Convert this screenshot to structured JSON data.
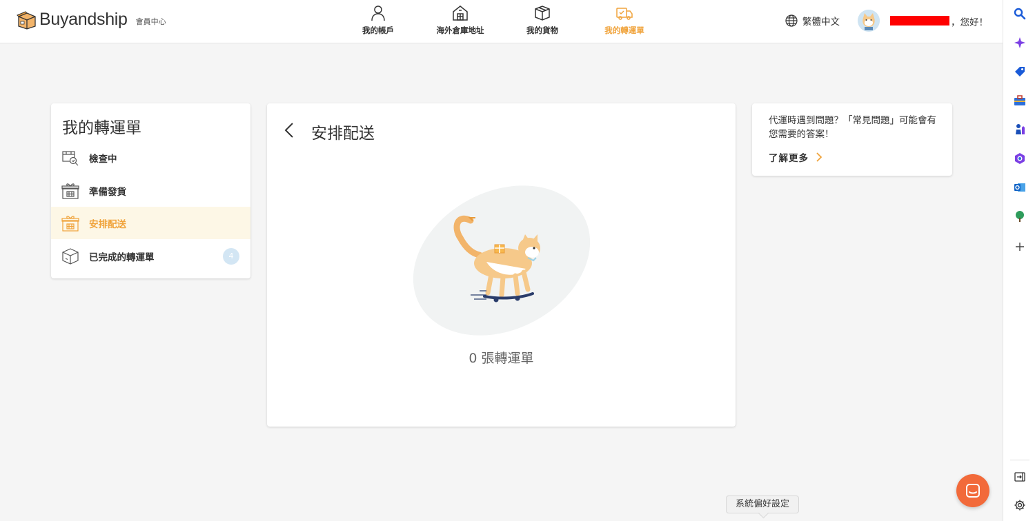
{
  "brand": {
    "name": "Buyandship",
    "subtitle": "會員中心"
  },
  "nav": {
    "items": [
      {
        "label": "我的帳戶",
        "icon": "user-icon"
      },
      {
        "label": "海外倉庫地址",
        "icon": "warehouse-icon"
      },
      {
        "label": "我的貨物",
        "icon": "box-icon"
      },
      {
        "label": "我的轉運單",
        "icon": "truck-icon",
        "active": true
      }
    ]
  },
  "header": {
    "language": "繁體中文",
    "greeting": "，您好！"
  },
  "sidebar": {
    "title": "我的轉運單",
    "items": [
      {
        "label": "檢查中",
        "icon": "inspect-icon"
      },
      {
        "label": "準備發貨",
        "icon": "gift-box-icon"
      },
      {
        "label": "安排配送",
        "icon": "gift-box-icon",
        "active": true
      },
      {
        "label": "已完成的轉運單",
        "icon": "cube-icon",
        "badge": "4"
      }
    ]
  },
  "main": {
    "title": "安排配送",
    "empty_text": "0 張轉運單"
  },
  "faq": {
    "text": "代運時遇到問題？「常見問題」可能會有您需要的答案！",
    "link": "了解更多"
  },
  "tooltip": {
    "text": "系統偏好設定"
  },
  "colors": {
    "accent": "#f0a33b",
    "active_bg": "#fdf7e6",
    "chat": "#f26a3a"
  }
}
